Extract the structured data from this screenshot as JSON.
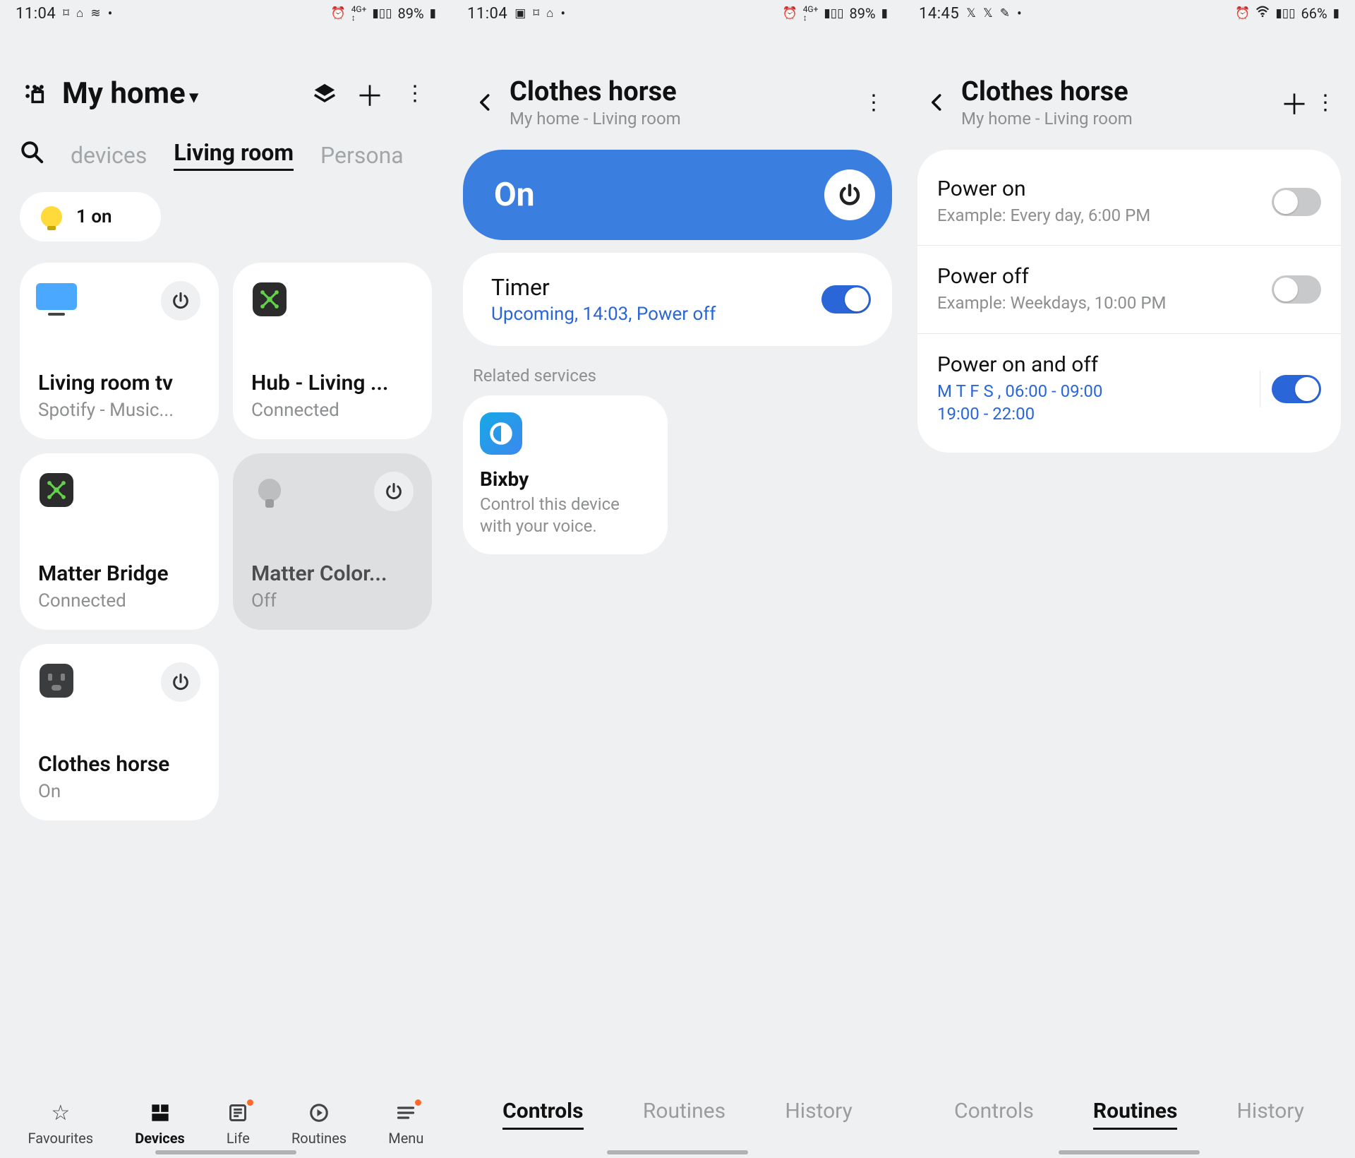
{
  "screens": [
    {
      "statusbar": {
        "time": "11:04",
        "battery": "89%",
        "left_icons": [
          "casting",
          "home",
          "weather",
          "•"
        ],
        "right_icons": [
          "alarm",
          "4G+",
          "signal"
        ]
      },
      "header": {
        "title": "My home",
        "actions": {
          "3d_map": "map-3d-icon",
          "add": "+",
          "more": "⋮"
        }
      },
      "tabs": {
        "left_dim": "devices",
        "active": "Living room",
        "right_dim": "Persona"
      },
      "summary": {
        "label": "1 on"
      },
      "devices": [
        {
          "name": "Living room tv",
          "status": "Spotify - Music...",
          "icon": "tv",
          "has_power": true,
          "off": false
        },
        {
          "name": "Hub - Living ...",
          "status": "Connected",
          "icon": "hub",
          "has_power": false,
          "off": false
        },
        {
          "name": "Matter Bridge",
          "status": "Connected",
          "icon": "hub",
          "has_power": false,
          "off": false
        },
        {
          "name": "Matter Color...",
          "status": "Off",
          "icon": "bulb",
          "has_power": true,
          "off": true
        },
        {
          "name": "Clothes horse",
          "status": "On",
          "icon": "plug",
          "has_power": true,
          "off": false
        }
      ],
      "nav": [
        {
          "label": "Favourites",
          "icon": "☆",
          "active": false,
          "dot": false
        },
        {
          "label": "Devices",
          "icon": "grid",
          "active": true,
          "dot": false
        },
        {
          "label": "Life",
          "icon": "news",
          "active": false,
          "dot": true
        },
        {
          "label": "Routines",
          "icon": "play",
          "active": false,
          "dot": false
        },
        {
          "label": "Menu",
          "icon": "menu",
          "active": false,
          "dot": true
        }
      ]
    },
    {
      "statusbar": {
        "time": "11:04",
        "battery": "89%",
        "left_icons": [
          "image",
          "casting",
          "home",
          "•"
        ],
        "right_icons": [
          "alarm",
          "4G+",
          "signal"
        ]
      },
      "header": {
        "title": "Clothes horse",
        "subtitle": "My home - Living room",
        "actions": {
          "more": "⋮"
        }
      },
      "on_panel": {
        "label": "On"
      },
      "timer": {
        "title": "Timer",
        "detail": "Upcoming, 14:03, Power off",
        "on": true
      },
      "related_label": "Related services",
      "bixby": {
        "name": "Bixby",
        "desc": "Control this device with your voice."
      },
      "tabs": [
        {
          "label": "Controls",
          "active": true
        },
        {
          "label": "Routines",
          "active": false
        },
        {
          "label": "History",
          "active": false
        }
      ]
    },
    {
      "statusbar": {
        "time": "14:45",
        "battery": "66%",
        "left_icons": [
          "X",
          "X",
          "pen",
          "•"
        ],
        "right_icons": [
          "alarm",
          "wifi",
          "signal"
        ]
      },
      "header": {
        "title": "Clothes horse",
        "subtitle": "My home - Living room",
        "actions": {
          "add": "+",
          "more": "⋮"
        }
      },
      "routines": [
        {
          "title": "Power on",
          "detail": "Example: Every day, 6:00 PM",
          "on": false,
          "blue": false,
          "divider": false
        },
        {
          "title": "Power off",
          "detail": "Example: Weekdays, 10:00 PM",
          "on": false,
          "blue": false,
          "divider": false
        },
        {
          "title": "Power on and off",
          "detail": "M T F S , 06:00 - 09:00\n19:00 - 22:00",
          "on": true,
          "blue": true,
          "divider": true
        }
      ],
      "tabs": [
        {
          "label": "Controls",
          "active": false
        },
        {
          "label": "Routines",
          "active": true
        },
        {
          "label": "History",
          "active": false
        }
      ]
    }
  ]
}
